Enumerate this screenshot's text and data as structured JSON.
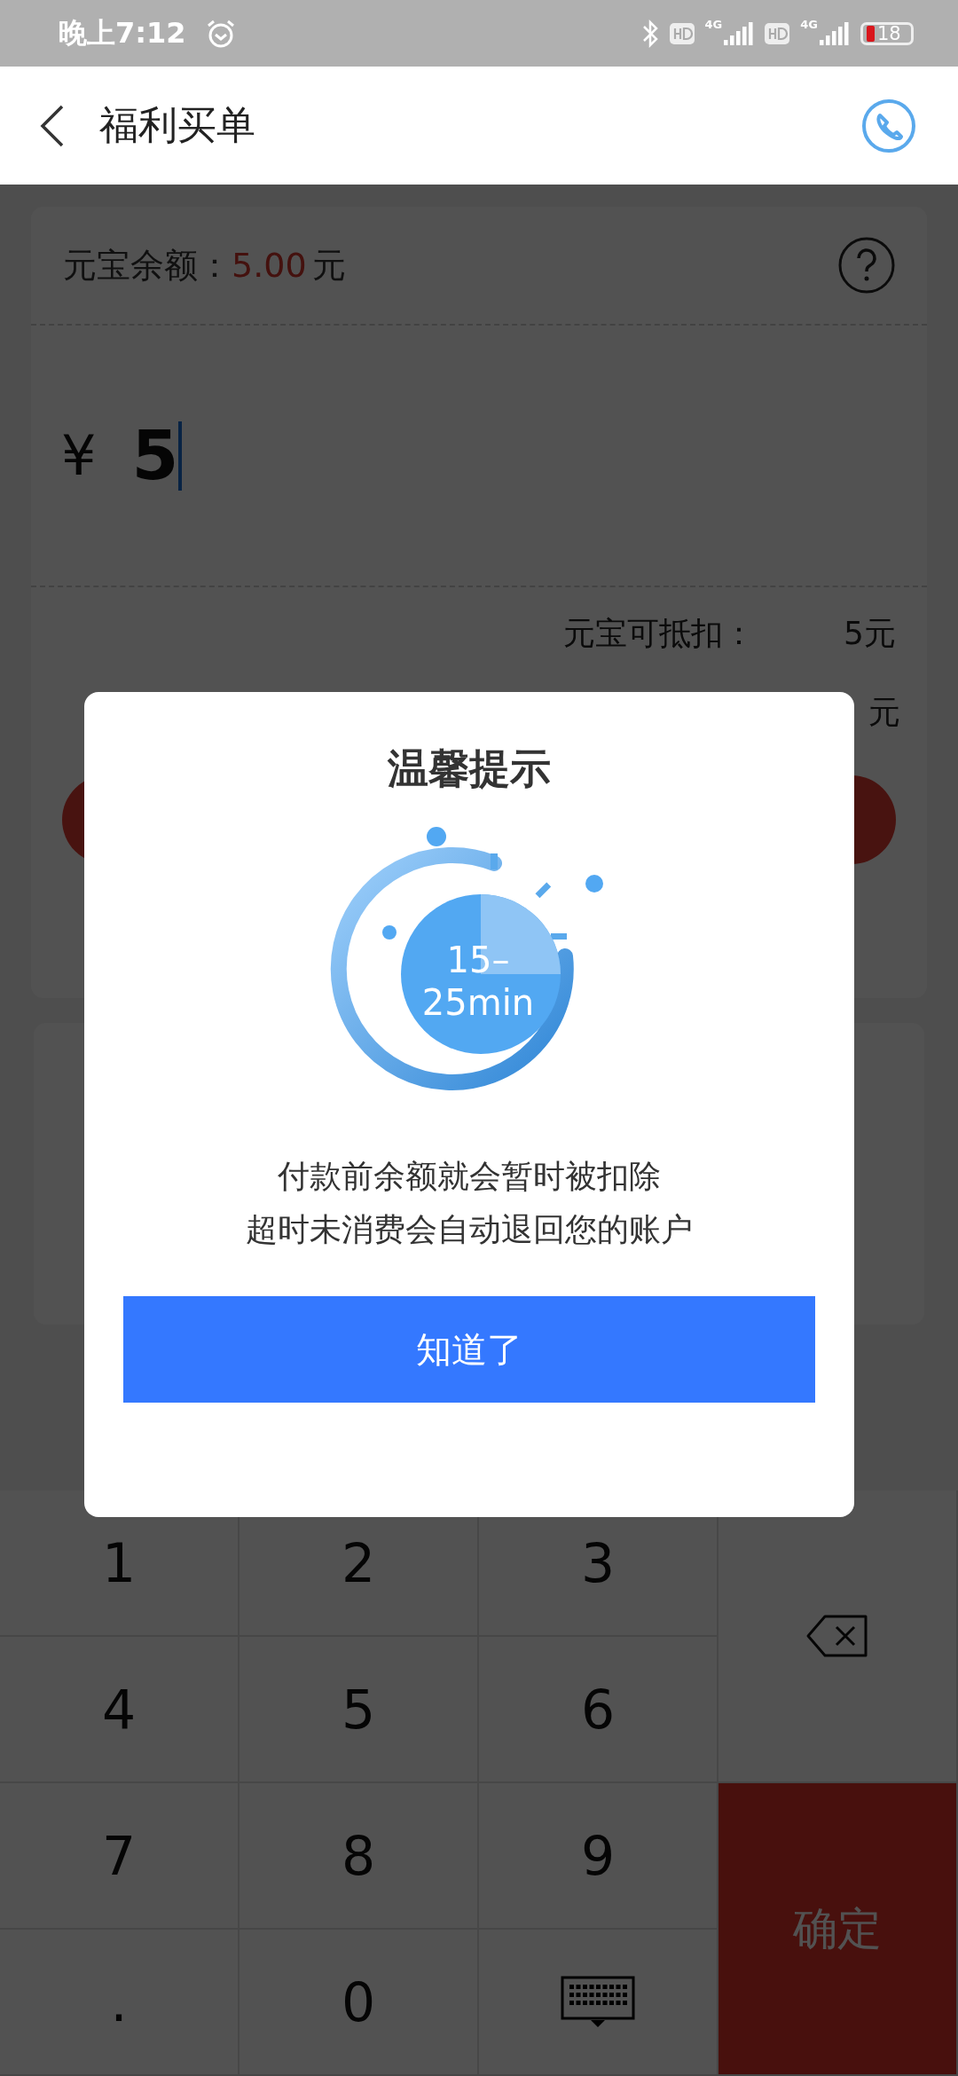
{
  "status_bar": {
    "time": "晚上7:12",
    "network": [
      "4G",
      "4G"
    ],
    "battery": "18"
  },
  "header": {
    "title": "福利买单"
  },
  "balance": {
    "label": "元宝余额：",
    "amount": "5.00",
    "unit": "元"
  },
  "amount_field": {
    "currency": "¥",
    "value": "5"
  },
  "deduction": {
    "label": "元宝可抵扣：",
    "value": "5元"
  },
  "partial_row": {
    "value": "元"
  },
  "keypad": [
    {
      "kind": "digit",
      "label": "1"
    },
    {
      "kind": "digit",
      "label": "2"
    },
    {
      "kind": "digit",
      "label": "3"
    },
    {
      "kind": "backspace"
    },
    {
      "kind": "digit",
      "label": "4"
    },
    {
      "kind": "digit",
      "label": "5"
    },
    {
      "kind": "digit",
      "label": "6"
    },
    {
      "kind": "digit",
      "label": "7"
    },
    {
      "kind": "digit",
      "label": "8"
    },
    {
      "kind": "digit",
      "label": "9"
    },
    {
      "kind": "confirm",
      "label": "确定"
    },
    {
      "kind": "digit",
      "label": "."
    },
    {
      "kind": "digit",
      "label": "0"
    },
    {
      "kind": "hide"
    }
  ],
  "dialog": {
    "title": "温馨提示",
    "timer_lines": [
      "15–",
      "25min"
    ],
    "message": [
      "付款前余额就会暂时被扣除",
      "超时未消费会自动退回您的账户"
    ],
    "button": "知道了"
  }
}
